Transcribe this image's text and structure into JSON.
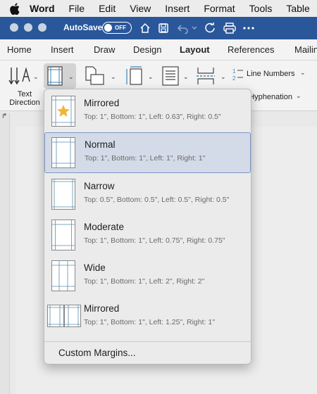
{
  "menubar": {
    "items": [
      "Word",
      "File",
      "Edit",
      "View",
      "Insert",
      "Format",
      "Tools",
      "Table"
    ]
  },
  "titlebar": {
    "autosave_label": "AutoSave",
    "autosave_state": "OFF"
  },
  "tabs": [
    "Home",
    "Insert",
    "Draw",
    "Design",
    "Layout",
    "References",
    "Mailings"
  ],
  "active_tab": "Layout",
  "ribbon": {
    "text_direction_label": "Text Direction",
    "line_numbers_label": "Line Numbers",
    "hyphenation_label": "Hyphenation"
  },
  "margins_menu": {
    "items": [
      {
        "title": "Mirrored",
        "details": "Top: 1\", Bottom: 1\", Left: 0.63\", Right: 0.5\""
      },
      {
        "title": "Normal",
        "details": "Top: 1\", Bottom: 1\", Left: 1\", Right: 1\""
      },
      {
        "title": "Narrow",
        "details": "Top: 0.5\", Bottom: 0.5\", Left: 0.5\", Right: 0.5\""
      },
      {
        "title": "Moderate",
        "details": "Top: 1\", Bottom: 1\", Left: 0.75\", Right: 0.75\""
      },
      {
        "title": "Wide",
        "details": "Top: 1\", Bottom: 1\", Left: 2\", Right: 2\""
      },
      {
        "title": "Mirrored",
        "details": "Top: 1\", Bottom: 1\", Left: 1.25\", Right: 1\""
      }
    ],
    "selected": "Normal",
    "custom_label": "Custom Margins..."
  },
  "colors": {
    "titlebar": "#2a579a",
    "selection": "#d4dbe8",
    "star": "#f2b53a",
    "margin_guides": "#5a8fb0"
  }
}
